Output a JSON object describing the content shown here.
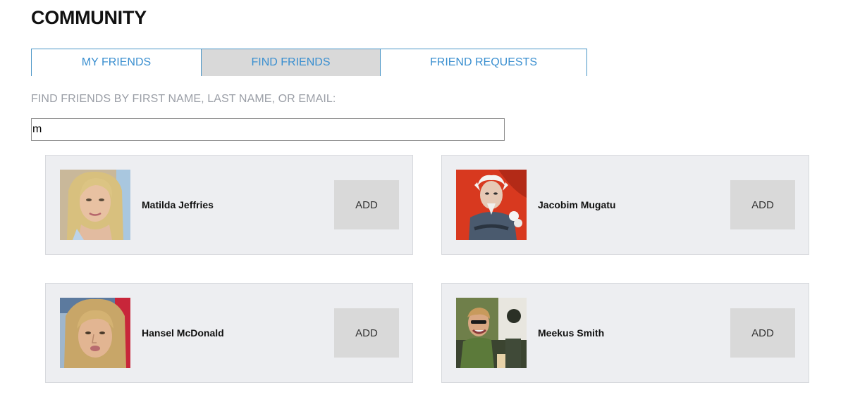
{
  "page": {
    "title": "COMMUNITY"
  },
  "tabs": [
    {
      "label": "MY FRIENDS",
      "active": false
    },
    {
      "label": "FIND FRIENDS",
      "active": true
    },
    {
      "label": "FRIEND REQUESTS",
      "active": false
    }
  ],
  "search": {
    "label": "FIND FRIENDS BY FIRST NAME, LAST NAME, OR EMAIL:",
    "value": "m"
  },
  "results": [
    {
      "name": "Matilda Jeffries",
      "add_label": "ADD",
      "avatar": "photo-blonde-woman"
    },
    {
      "name": "Jacobim Mugatu",
      "add_label": "ADD",
      "avatar": "photo-white-haired-man"
    },
    {
      "name": "Hansel McDonald",
      "add_label": "ADD",
      "avatar": "photo-blond-man"
    },
    {
      "name": "Meekus Smith",
      "add_label": "ADD",
      "avatar": "photo-man-sunglasses"
    }
  ],
  "colors": {
    "tab_text": "#3a8fd0",
    "tab_border": "#4a95c6",
    "tab_active_bg": "#d9d9d9",
    "card_bg": "#edeef1",
    "button_bg": "#d9d9d9",
    "label_gray": "#9a9ea6"
  }
}
